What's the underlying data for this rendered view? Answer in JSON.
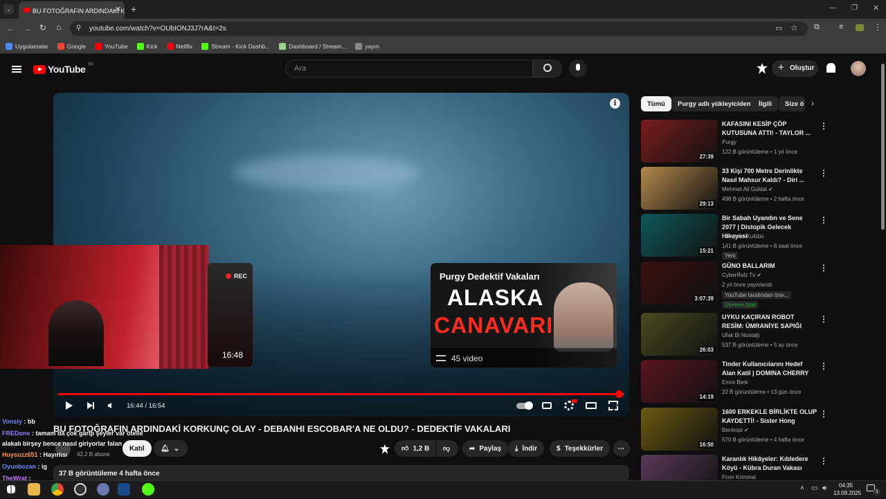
{
  "browser": {
    "tab_title": "BU FOTOĞRAFIN ARDINDAKİ K",
    "url": "youtube.com/watch?v=OUbIONJ3J7rA&t=2s",
    "bookmarks": [
      {
        "label": "Uygulamalar",
        "color": "#4a8af4"
      },
      {
        "label": "Google",
        "color": "#ea4335"
      },
      {
        "label": "YouTube",
        "color": "#ff0000"
      },
      {
        "label": "Kick",
        "color": "#53fc18"
      },
      {
        "label": "Netflix",
        "color": "#e50914"
      },
      {
        "label": "Stream - Kick Dashb...",
        "color": "#53fc18"
      },
      {
        "label": "Dashboard / Stream...",
        "color": "#9ad08a"
      },
      {
        "label": "yayın",
        "color": "#888888"
      }
    ]
  },
  "youtube": {
    "logo": "YouTube",
    "logo_region": "TR",
    "search_placeholder": "Ara",
    "create_label": "Oluştur"
  },
  "player": {
    "time": "16:44 / 16:54",
    "progress_fraction": 0.99,
    "endcard": {
      "channel": "Purgy Dedektif Vakaları",
      "line1": "ALASKA",
      "line2": "CANAVARI",
      "count": "45 video"
    },
    "pip_card": {
      "rec": "REC",
      "duration": "16:48"
    }
  },
  "video": {
    "title": "BU FOTOĞRAFIN ARDINDAKİ KORKUNÇ OLAY - DEBANHI ESCOBAR'A NE OLDU? - DEDEKTİF VAKALARI",
    "subscribers": "42,2 B abone",
    "join_label": "Katıl",
    "likes": "1,2 B",
    "share_label": "Paylaş",
    "download_label": "İndir",
    "thanks_label": "Teşekkürler",
    "views_date": "37 B görüntüleme  4 hafta önce"
  },
  "chat": [
    {
      "user": "Vonsly",
      "color": "#6a8fff",
      "text": "bb"
    },
    {
      "user": "FREDone",
      "color": "#9a7cff",
      "text": "tamam da çok garip şeyler var ötelle"
    },
    {
      "user": "",
      "color": "#ffffff",
      "text": "alakalı birşey bence nasıl giriyorlar falan"
    },
    {
      "user": "Huysuzz651",
      "color": "#ff9a3c",
      "text": "Hayırlısı"
    },
    {
      "user": "Oyunbozan",
      "color": "#6a8fff",
      "text": "ig"
    },
    {
      "user": "TheWrat",
      "color": "#c27cff",
      "text": ""
    },
    {
      "user": "Vonsly",
      "color": "#6a8fff",
      "text": ""
    }
  ],
  "sidebar": {
    "chips": [
      "Tümü",
      "Purgy adlı yükleyiciden",
      "İlgili",
      "Size ö"
    ],
    "items": [
      {
        "title": "KAFASINI KESİP ÇÖP KUTUSUNA ATTI! - TAYLOR ...",
        "channel": "Purgy",
        "meta": "122 B görüntüleme • 1 yıl önce",
        "duration": "27:39",
        "thumb": "#7a1d1d",
        "verified": false,
        "tag": ""
      },
      {
        "title": "33 Kişi 700 Metre Derinlikte Nasıl Mahsur Kaldı? - Diri ...",
        "channel": "Mehmet Ali Güldal",
        "meta": "498 B görüntüleme • 2 hafta önce",
        "duration": "29:13",
        "thumb": "#b58a4b",
        "verified": true,
        "tag": ""
      },
      {
        "title": "Bir Sabah Uyandın ve Sene 2077 | Distopik Gelecek Hikayesi",
        "channel": "Hikayeler Kulübü",
        "meta": "141 B görüntüleme • 8 saat önce",
        "duration": "15:21",
        "thumb": "#0f5a5a",
        "verified": false,
        "tag": "Yeni"
      },
      {
        "title": "GÜNO BALLARIM",
        "channel": "CyberRulz Tv",
        "meta": "2 yıl önce yayınlandı",
        "duration": "3:07:39",
        "thumb": "#3a1010",
        "verified": true,
        "tag": "YouTube tarafından öne..."
      },
      {
        "title": "UYKU KAÇIRAN ROBOT RESİM: ÜMRANİYE SAPIĞI",
        "channel": "Ufak Bi Nostalji",
        "meta": "537 B görüntüleme • 5 ay önce",
        "duration": "26:03",
        "thumb": "#4a4a20",
        "verified": false,
        "tag": ""
      },
      {
        "title": "Tinder Kullanıcılarını Hedef Alan Katil | DOMINA CHERRY",
        "channel": "Emre Berk",
        "meta": "22 B görüntüleme • 13 gün önce",
        "duration": "14:19",
        "thumb": "#5a1520",
        "verified": false,
        "tag": ""
      },
      {
        "title": "1600 ERKEKLE BİRLİKTE OLUP KAYDETTİ! - Sister Hong",
        "channel": "Bentropi",
        "meta": "570 B görüntüleme • 4 hafta önce",
        "duration": "16:50",
        "thumb": "#6a5a10",
        "verified": true,
        "tag": ""
      },
      {
        "title": "Karanlık Hikâyeler: Kıbledere Köyü - Kübra Duran Vakası",
        "channel": "Fcon Kriminal",
        "meta": "",
        "duration": "",
        "thumb": "#5a3a5a",
        "verified": false,
        "tag": ""
      }
    ],
    "members_badge": "Üyelere özel"
  },
  "taskbar": {
    "time": "04:35",
    "date": "13.09.2025",
    "notif_count": "1"
  }
}
